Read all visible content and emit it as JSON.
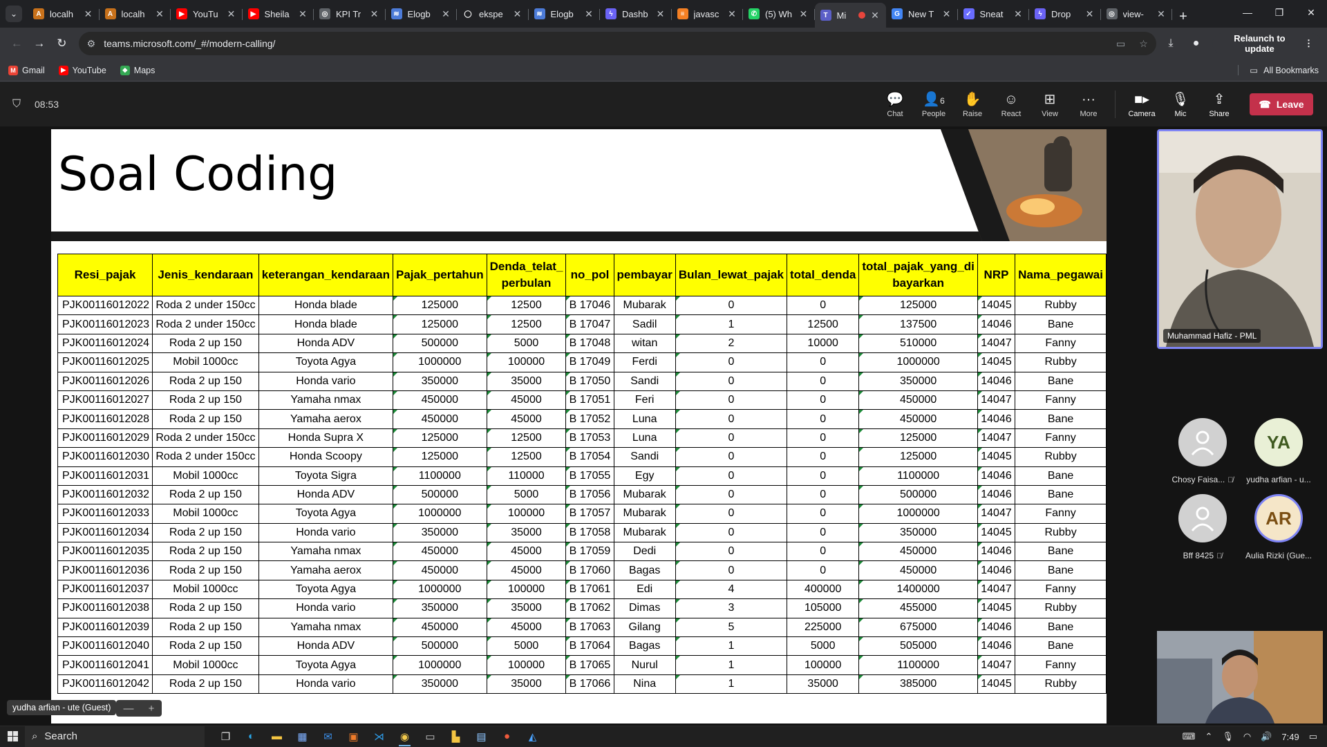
{
  "browser": {
    "tabs": [
      {
        "title": "localh",
        "icon_color": "#c8711b",
        "icon": "A",
        "active": false
      },
      {
        "title": "localh",
        "icon_color": "#c8711b",
        "icon": "A",
        "active": false
      },
      {
        "title": "YouTu",
        "icon_color": "#ff0000",
        "icon": "▶",
        "active": false
      },
      {
        "title": "Sheila",
        "icon_color": "#ff0000",
        "icon": "▶",
        "active": false
      },
      {
        "title": "KPI Tr",
        "icon_color": "#5f6368",
        "icon": "◎",
        "active": false
      },
      {
        "title": "Elogb",
        "icon_color": "#4c7bd8",
        "icon": "≋",
        "active": false
      },
      {
        "title": "ekspe",
        "icon_color": "#202124",
        "icon": "◯",
        "active": false
      },
      {
        "title": "Elogb",
        "icon_color": "#4c7bd8",
        "icon": "≋",
        "active": false
      },
      {
        "title": "Dashb",
        "icon_color": "#6b63f5",
        "icon": "ϟ",
        "active": false
      },
      {
        "title": "javasc",
        "icon_color": "#f48024",
        "icon": "≡",
        "active": false
      },
      {
        "title": "(5) Wh",
        "icon_color": "#25d366",
        "icon": "✆",
        "active": false
      },
      {
        "title": "Mi",
        "icon_color": "#5b5fc7",
        "icon": "T",
        "active": true
      },
      {
        "title": "New T",
        "icon_color": "#4285f4",
        "icon": "G",
        "active": false
      },
      {
        "title": "Sneat",
        "icon_color": "#696cff",
        "icon": "✓",
        "active": false
      },
      {
        "title": "Drop",
        "icon_color": "#6b63f5",
        "icon": "ϟ",
        "active": false
      },
      {
        "title": "view-",
        "icon_color": "#5f6368",
        "icon": "◎",
        "active": false
      }
    ],
    "url": "teams.microsoft.com/_#/modern-calling/",
    "relaunch_label": "Relaunch to update",
    "bookmarks": [
      {
        "label": "Gmail",
        "icon_color": "#ea4335",
        "icon": "M"
      },
      {
        "label": "YouTube",
        "icon_color": "#ff0000",
        "icon": "▶"
      },
      {
        "label": "Maps",
        "icon_color": "#34a853",
        "icon": "◆"
      }
    ],
    "all_bookmarks_label": "All Bookmarks"
  },
  "call": {
    "timer": "08:53",
    "people_count": "6",
    "controls": {
      "chat": "Chat",
      "people": "People",
      "raise": "Raise",
      "react": "React",
      "view": "View",
      "more": "More",
      "camera": "Camera",
      "mic": "Mic",
      "share": "Share",
      "leave": "Leave"
    },
    "accent": "#c4314b"
  },
  "slide": {
    "title": "Soal Coding",
    "header_fill": "#ffff00",
    "columns": [
      "Resi_pajak",
      "Jenis_kendaraan",
      "keterangan_kendaraan",
      "Pajak_pertahun",
      "Denda_telat_ perbulan",
      "no_pol",
      "pembayar",
      "Bulan_lewat_pajak",
      "total_denda",
      "total_pajak_yang_di bayarkan",
      "NRP",
      "Nama_pegawai"
    ],
    "rows": [
      [
        "PJK00116012022",
        "Roda 2 under 150cc",
        "Honda blade",
        "125000",
        "12500",
        "B 17046",
        "Mubarak",
        "0",
        "0",
        "125000",
        "14045",
        "Rubby"
      ],
      [
        "PJK00116012023",
        "Roda 2 under 150cc",
        "Honda blade",
        "125000",
        "12500",
        "B 17047",
        "Sadil",
        "1",
        "12500",
        "137500",
        "14046",
        "Bane"
      ],
      [
        "PJK00116012024",
        "Roda 2 up 150",
        "Honda ADV",
        "500000",
        "5000",
        "B 17048",
        "witan",
        "2",
        "10000",
        "510000",
        "14047",
        "Fanny"
      ],
      [
        "PJK00116012025",
        "Mobil 1000cc",
        "Toyota Agya",
        "1000000",
        "100000",
        "B 17049",
        "Ferdi",
        "0",
        "0",
        "1000000",
        "14045",
        "Rubby"
      ],
      [
        "PJK00116012026",
        "Roda 2 up 150",
        "Honda vario",
        "350000",
        "35000",
        "B 17050",
        "Sandi",
        "0",
        "0",
        "350000",
        "14046",
        "Bane"
      ],
      [
        "PJK00116012027",
        "Roda 2 up 150",
        "Yamaha nmax",
        "450000",
        "45000",
        "B 17051",
        "Feri",
        "0",
        "0",
        "450000",
        "14047",
        "Fanny"
      ],
      [
        "PJK00116012028",
        "Roda 2 up 150",
        "Yamaha aerox",
        "450000",
        "45000",
        "B 17052",
        "Luna",
        "0",
        "0",
        "450000",
        "14046",
        "Bane"
      ],
      [
        "PJK00116012029",
        "Roda 2 under 150cc",
        "Honda Supra X",
        "125000",
        "12500",
        "B 17053",
        "Luna",
        "0",
        "0",
        "125000",
        "14047",
        "Fanny"
      ],
      [
        "PJK00116012030",
        "Roda 2 under 150cc",
        "Honda Scoopy",
        "125000",
        "12500",
        "B 17054",
        "Sandi",
        "0",
        "0",
        "125000",
        "14045",
        "Rubby"
      ],
      [
        "PJK00116012031",
        "Mobil 1000cc",
        "Toyota Sigra",
        "1100000",
        "110000",
        "B 17055",
        "Egy",
        "0",
        "0",
        "1100000",
        "14046",
        "Bane"
      ],
      [
        "PJK00116012032",
        "Roda 2 up 150",
        "Honda ADV",
        "500000",
        "5000",
        "B 17056",
        "Mubarak",
        "0",
        "0",
        "500000",
        "14046",
        "Bane"
      ],
      [
        "PJK00116012033",
        "Mobil 1000cc",
        "Toyota Agya",
        "1000000",
        "100000",
        "B 17057",
        "Mubarak",
        "0",
        "0",
        "1000000",
        "14047",
        "Fanny"
      ],
      [
        "PJK00116012034",
        "Roda 2 up 150",
        "Honda vario",
        "350000",
        "35000",
        "B 17058",
        "Mubarak",
        "0",
        "0",
        "350000",
        "14045",
        "Rubby"
      ],
      [
        "PJK00116012035",
        "Roda 2 up 150",
        "Yamaha nmax",
        "450000",
        "45000",
        "B 17059",
        "Dedi",
        "0",
        "0",
        "450000",
        "14046",
        "Bane"
      ],
      [
        "PJK00116012036",
        "Roda 2 up 150",
        "Yamaha aerox",
        "450000",
        "45000",
        "B 17060",
        "Bagas",
        "0",
        "0",
        "450000",
        "14046",
        "Bane"
      ],
      [
        "PJK00116012037",
        "Mobil 1000cc",
        "Toyota Agya",
        "1000000",
        "100000",
        "B 17061",
        "Edi",
        "4",
        "400000",
        "1400000",
        "14047",
        "Fanny"
      ],
      [
        "PJK00116012038",
        "Roda 2 up 150",
        "Honda vario",
        "350000",
        "35000",
        "B 17062",
        "Dimas",
        "3",
        "105000",
        "455000",
        "14045",
        "Rubby"
      ],
      [
        "PJK00116012039",
        "Roda 2 up 150",
        "Yamaha nmax",
        "450000",
        "45000",
        "B 17063",
        "Gilang",
        "5",
        "225000",
        "675000",
        "14046",
        "Bane"
      ],
      [
        "PJK00116012040",
        "Roda 2 up 150",
        "Honda ADV",
        "500000",
        "5000",
        "B 17064",
        "Bagas",
        "1",
        "5000",
        "505000",
        "14046",
        "Bane"
      ],
      [
        "PJK00116012041",
        "Mobil 1000cc",
        "Toyota Agya",
        "1000000",
        "100000",
        "B 17065",
        "Nurul",
        "1",
        "100000",
        "1100000",
        "14047",
        "Fanny"
      ],
      [
        "PJK00116012042",
        "Roda 2 up 150",
        "Honda vario",
        "350000",
        "35000",
        "B 17066",
        "Nina",
        "1",
        "35000",
        "385000",
        "14045",
        "Rubby"
      ]
    ]
  },
  "participants": {
    "main_video_name": "Muhammad Hafiz - PML",
    "tiles": [
      {
        "name": "Chosy Faisa...",
        "initials": "",
        "muted": true
      },
      {
        "name": "yudha arfian - u...",
        "initials": "YA",
        "muted": false
      },
      {
        "name": "Bff 8425",
        "initials": "",
        "muted": true
      },
      {
        "name": "Aulia Rizki (Gue...",
        "initials": "AR",
        "muted": false
      }
    ],
    "sharer": "yudha arfian - ute (Guest)"
  },
  "taskbar": {
    "search_placeholder": "Search",
    "time": "7:49"
  }
}
